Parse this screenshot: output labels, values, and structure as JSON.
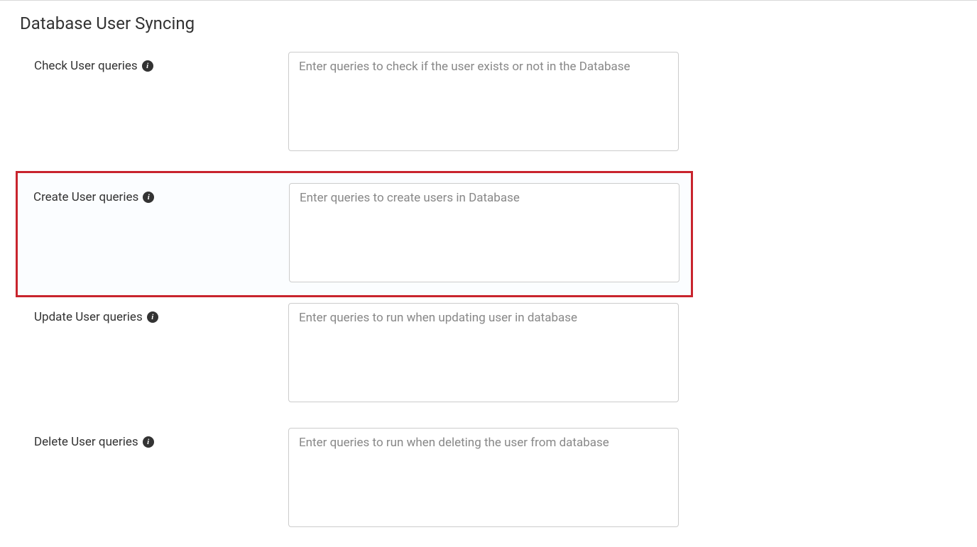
{
  "section": {
    "title": "Database User Syncing"
  },
  "fields": {
    "check_user": {
      "label": "Check User queries",
      "placeholder": "Enter queries to check if the user exists or not in the Database",
      "value": ""
    },
    "create_user": {
      "label": "Create User queries",
      "placeholder": "Enter queries to create users in Database",
      "value": ""
    },
    "update_user": {
      "label": "Update User queries",
      "placeholder": "Enter queries to run when updating user in database",
      "value": ""
    },
    "delete_user": {
      "label": "Delete User queries",
      "placeholder": "Enter queries to run when deleting the user from database",
      "value": ""
    }
  },
  "icons": {
    "info_glyph": "i"
  }
}
